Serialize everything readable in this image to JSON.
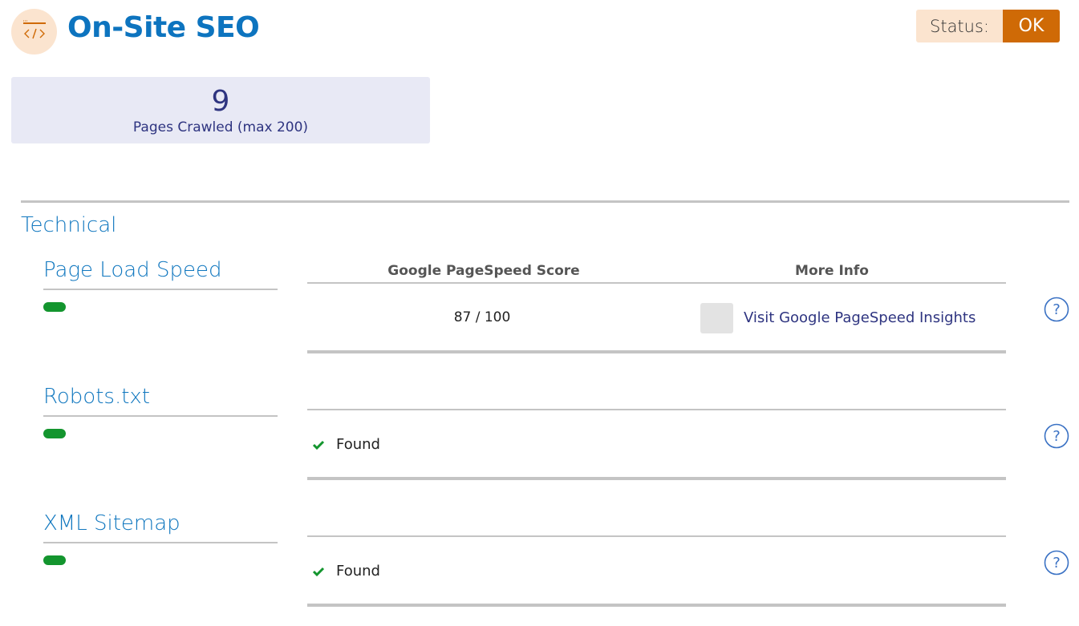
{
  "header": {
    "icon": "code-icon",
    "title": "On-Site SEO",
    "status_label": "Status:",
    "status_value": "OK"
  },
  "stats": {
    "pages_crawled": "9",
    "pages_crawled_label": "Pages Crawled (max 200)"
  },
  "section": {
    "title": "Technical"
  },
  "checks": [
    {
      "label": "Page Load Speed",
      "status": "pass",
      "table": {
        "headers": [
          "Google PageSpeed Score",
          "More Info"
        ],
        "score": "87 / 100",
        "link_text": "Visit Google PageSpeed Insights"
      },
      "help_icon": "question-circle-icon"
    },
    {
      "label": "Robots.txt",
      "status": "pass",
      "result_icon": "check-icon",
      "result": "Found",
      "help_icon": "question-circle-icon"
    },
    {
      "label": "XML Sitemap",
      "status": "pass",
      "result_icon": "check-icon",
      "result": "Found",
      "help_icon": "question-circle-icon"
    }
  ],
  "colors": {
    "brand_blue": "#0d74bf",
    "status_ok": "#cf6a06",
    "pass_green": "#13952e",
    "stat_text": "#2e3480"
  }
}
